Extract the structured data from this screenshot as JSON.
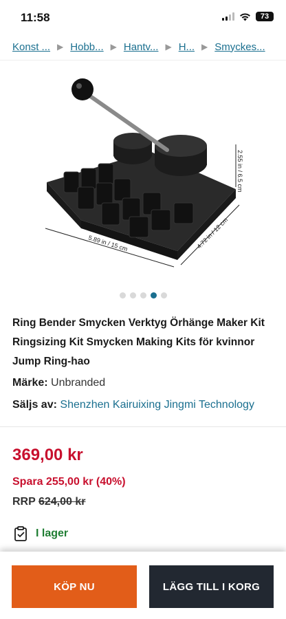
{
  "status_bar": {
    "time": "11:58",
    "battery": "73"
  },
  "breadcrumb": [
    "Konst ...",
    "Hobb...",
    "Hantv...",
    "H...",
    "Smyckes..."
  ],
  "product_image": {
    "dim_width": "5.89 in / 15 cm",
    "dim_depth": "4.72 in / 12 cm",
    "dim_height": "2.55 in / 6.5 cm"
  },
  "gallery": {
    "count": 5,
    "active": 3
  },
  "product": {
    "title": "Ring Bender Smycken Verktyg Örhänge Maker Kit Ringsizing Kit Smycken Making Kits för kvinnor Jump Ring-hao",
    "brand_label": "Märke:",
    "brand_value": "Unbranded",
    "seller_label": "Säljs av:",
    "seller_value": "Shenzhen Kairuixing Jingmi Technology"
  },
  "pricing": {
    "price": "369,00 kr",
    "save": "Spara 255,00 kr (40%)",
    "rrp_label": "RRP",
    "rrp_value": "624,00 kr"
  },
  "stock": {
    "label": "I lager"
  },
  "actions": {
    "buy": "KÖP NU",
    "add_to_cart": "LÄGG TILL I KORG"
  }
}
